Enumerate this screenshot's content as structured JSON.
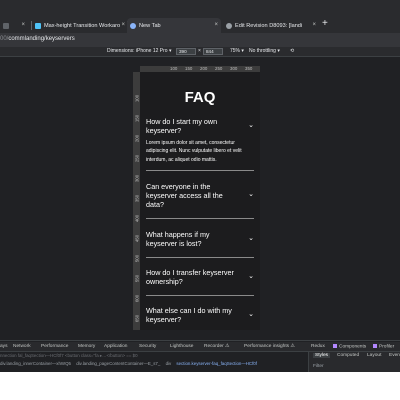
{
  "tabs": [
    {
      "label": "",
      "color": "#5f6368"
    },
    {
      "label": "Max-height Transition Workaro",
      "color": "#4fc3f7"
    },
    {
      "label": "New Tab",
      "color": "#8ab4f8"
    },
    {
      "label": "Edit Revision D8093: [landi",
      "color": "#9aa0a6"
    }
  ],
  "new_tab_icon": "+",
  "address": {
    "host": "00/",
    "path": "commlanding/keyservers"
  },
  "device_toolbar": {
    "dimensions_label": "Dimensions: iPhone 12 Pro",
    "width": "390",
    "times": "×",
    "height": "844",
    "zoom": "75%",
    "throttle": "No throttling"
  },
  "ruler": {
    "h": [
      "100",
      "150",
      "200",
      "250",
      "300",
      "350"
    ],
    "v": [
      "100",
      "150",
      "200",
      "250",
      "300",
      "350",
      "400",
      "450",
      "500",
      "550",
      "600",
      "650"
    ]
  },
  "faq": {
    "title": "FAQ",
    "chevron": "⌄",
    "items": [
      {
        "question": "How do I start my own keyserver?",
        "answer": "Lorem ipsum dolor sit amet, consectetur adipiscing elit. Nunc vulputate libero et velit interdum, ac aliquet odio mattis."
      },
      {
        "question": "Can everyone in the keyserver access all the data?"
      },
      {
        "question": "What happens if my keyserver is lost?"
      },
      {
        "question": "How do I transfer keyserver ownership?"
      },
      {
        "question": "What else can I do with my keyserver?"
      }
    ]
  },
  "devtools": {
    "tabs": [
      "ays",
      "Network",
      "Performance",
      "Memory",
      "Application",
      "Security",
      "Lighthouse",
      "Recorder ⚠",
      "Performance insights ⚠",
      "Redux",
      "Components",
      "Profiler"
    ],
    "faint_line": "nnection fal_faqSection—HCf0f7   <button class=\"fa  ▸…</button>   == $0",
    "breadcrumbs": [
      "div.landing_innerContainer—xhWQ5",
      "div.landing_pageContentContainer—E_s7_",
      "div",
      "section.keyserver-faq_faqSection—HCf0f"
    ],
    "styles_tabs": [
      "Styles",
      "Computed",
      "Layout",
      "Even"
    ],
    "filter_placeholder": "Filter"
  }
}
